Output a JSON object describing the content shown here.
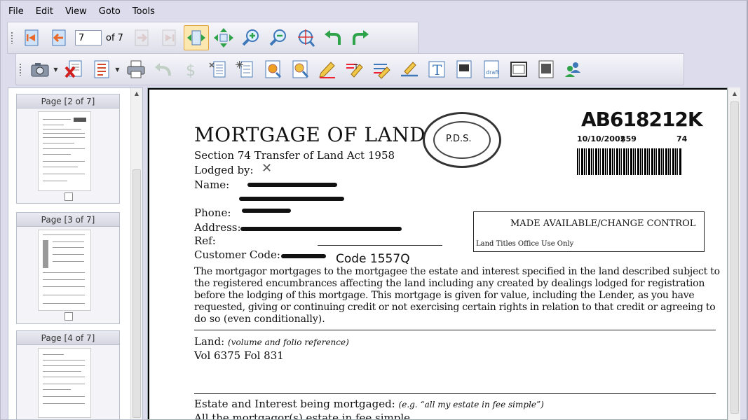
{
  "menu": [
    "File",
    "Edit",
    "View",
    "Goto",
    "Tools"
  ],
  "nav": {
    "page_value": "7",
    "of_label": "of",
    "total": "7"
  },
  "toolbar1_icons": [
    "first-page-icon",
    "previous-page-icon",
    "next-page-icon",
    "last-page-icon",
    "fit-width-icon",
    "fit-page-icon",
    "zoom-in-icon",
    "zoom-out-icon",
    "zoom-target-icon",
    "rotate-left-icon",
    "rotate-right-icon"
  ],
  "toolbar2_icons": [
    "camera-icon",
    "delete-page-icon",
    "properties-icon",
    "print-icon",
    "undo-icon",
    "redo-icon",
    "select-text-icon",
    "redact-icon",
    "image-capture-icon",
    "image-zoom-icon",
    "highlight-icon",
    "text-markup-icon",
    "strikeout-icon",
    "underline-icon",
    "typewriter-icon",
    "rectangle-fill-icon",
    "draft-stamp-icon",
    "note-icon",
    "form-icon",
    "users-icon"
  ],
  "thumbnails": [
    {
      "label": "Page [2 of 7]"
    },
    {
      "label": "Page [3 of 7]"
    },
    {
      "label": "Page [4 of 7]"
    }
  ],
  "document": {
    "title": "MORTGAGE OF LAND",
    "act": "Section 74 Transfer of Land Act 1958",
    "lodged_by": "Lodged by:",
    "name": "Name:",
    "phone": "Phone:",
    "address": "Address:",
    "ref": "Ref:",
    "customer_code": "Customer Code:",
    "code": "Code 1557Q",
    "doc_number": "AB618212K",
    "stamp_date": "10/10/2002",
    "stamp_fee": "$59",
    "stamp_num": "74",
    "stamp_text": "P.D.S.",
    "box_title": "MADE AVAILABLE/CHANGE CONTROL",
    "box_sub": "Land Titles Office Use Only",
    "para": [
      "The mortgagor mortgages to the mortgagee the estate and interest specified in the land described subject to",
      "the registered encumbrances affecting the land including any created by dealings lodged for registration",
      "before the lodging of this mortgage. This mortgage is given for value, including the Lender, as you have",
      "requested, giving or continuing credit or not exercising certain rights in relation to that credit or agreeing to",
      "do so (even conditionally)."
    ],
    "land_label": "Land:",
    "land_note": "(volume and folio reference)",
    "land_value": "Vol 6375 Fol 831",
    "estate_label": "Estate and Interest being mortgaged:",
    "estate_note": "(e.g. “all my estate in fee simple”)",
    "estate_value": "All the mortgagor(s) estate in fee simple"
  }
}
